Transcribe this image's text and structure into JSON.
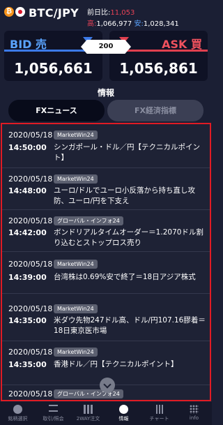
{
  "header": {
    "pair": "BTC/JPY",
    "change_label": "前日比:",
    "change_value": "11,053",
    "high_label": "高:",
    "high_value": "1,066,977",
    "low_label": "安:",
    "low_value": "1,028,341"
  },
  "bid": {
    "label": "BID 売",
    "price": "1,056,661"
  },
  "ask": {
    "label": "ASK 買",
    "price": "1,056,861"
  },
  "spread": "200",
  "info": {
    "title": "情報",
    "tabs": [
      {
        "label": "FXニュース",
        "active": true
      },
      {
        "label": "FX経済指標",
        "active": false
      }
    ]
  },
  "news": [
    {
      "date": "2020/05/18",
      "source": "MarketWin24",
      "time": "14:50:00",
      "headline": "シンガポール・ドル／円【テクニカルポイント】"
    },
    {
      "date": "2020/05/18",
      "source": "MarketWin24",
      "time": "14:48:00",
      "headline": "ユーロ/ドルでユーロ小反落から持ち直し攻防、ユーロ/円を下支え"
    },
    {
      "date": "2020/05/18",
      "source": "グローバル・インフォ24",
      "time": "14:42:00",
      "headline": "ボンドリアルタイムオーダー＝1.2070ドル割り込むとストップロス売り"
    },
    {
      "date": "2020/05/18",
      "source": "MarketWin24",
      "time": "14:39:00",
      "headline": "台湾株は0.69%安で終了＝18日アジア株式"
    },
    {
      "date": "2020/05/18",
      "source": "MarketWin24",
      "time": "14:35:00",
      "headline": "米ダウ先物247ドル高、ドル/円107.16膠着＝18日東京医市場"
    },
    {
      "date": "2020/05/18",
      "source": "MarketWin24",
      "time": "14:35:00",
      "headline": "香港ドル／円【テクニカルポイント】"
    },
    {
      "date": "2020/05/18",
      "source": "グローバル・インフォ24",
      "time": "",
      "headline": ""
    }
  ],
  "nav": [
    {
      "label": "銘柄選択",
      "icon": "coin-icon"
    },
    {
      "label": "取引/照会",
      "icon": "trade-icon"
    },
    {
      "label": "2WAY注文",
      "icon": "grid-icon"
    },
    {
      "label": "情報",
      "icon": "info-icon",
      "active": true
    },
    {
      "label": "チャート",
      "icon": "chart-icon"
    },
    {
      "label": "info",
      "icon": "dots-icon"
    }
  ],
  "colors": {
    "accent_red": "#e01b24",
    "bid_blue": "#3c7ae8",
    "ask_red": "#e0404f"
  }
}
